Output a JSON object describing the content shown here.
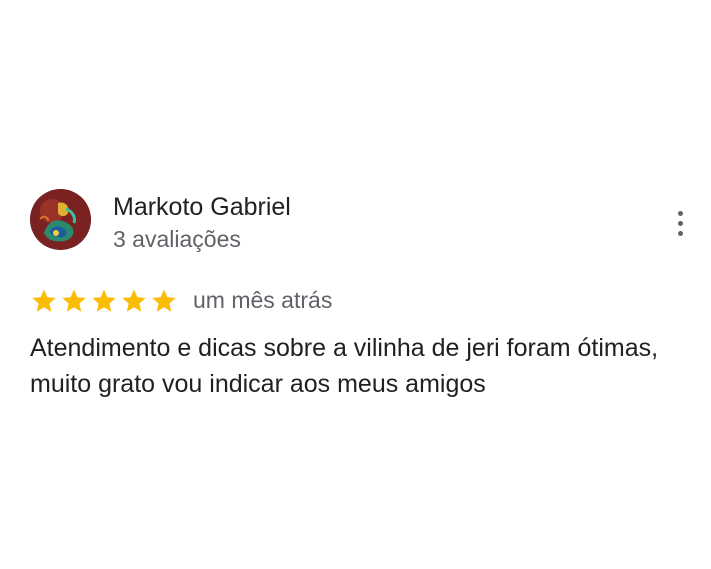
{
  "review": {
    "author_name": "Markoto Gabriel",
    "review_count": "3 avaliações",
    "rating": 5,
    "rating_max": 5,
    "date": "um mês atrás",
    "text_line_1": "Atendimento e dicas sobre a vilinha de jeri foram ótimas,",
    "text_line_2": "muito grato vou indicar aos meus amigos",
    "star_color": "#fbbc04",
    "more_icon": "more-vert-icon"
  }
}
